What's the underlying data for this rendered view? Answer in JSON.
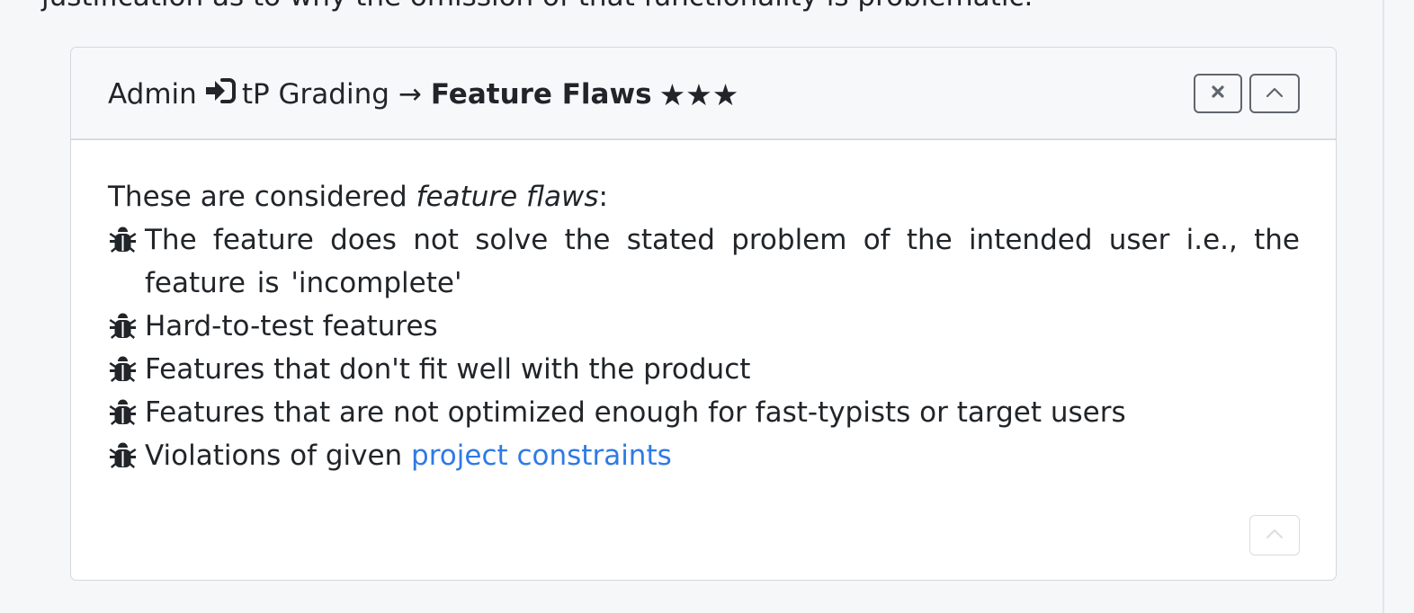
{
  "top_text": "justification as to why the omission of that functionality is problematic.",
  "panel": {
    "title": {
      "part1": "Admin",
      "login_icon": "sign-in-icon",
      "part2": "tP Grading",
      "arrow": "→",
      "bold": "Feature Flaws",
      "stars": "★★★"
    },
    "buttons": {
      "close_icon": "close-icon",
      "collapse_icon": "chevron-up-icon",
      "bottom_collapse_icon": "chevron-up-icon"
    },
    "body": {
      "intro_prefix": "These are considered ",
      "intro_em": "feature flaws",
      "intro_suffix": ":",
      "bullet_icon": "bug-icon",
      "items": [
        "The feature does not solve the stated problem of the intended user i.e., the feature is 'incomplete'",
        "Hard-to-test features",
        "Features that don't fit well with the product",
        "Features that are not optimized enough for fast-typists or target users"
      ],
      "last_item_prefix": "Violations of given ",
      "last_item_link": "project constraints"
    }
  },
  "colors": {
    "page_bg": "#f6f7f9",
    "text": "#212529",
    "link": "#2f7ae5",
    "border": "#d4d7db"
  }
}
